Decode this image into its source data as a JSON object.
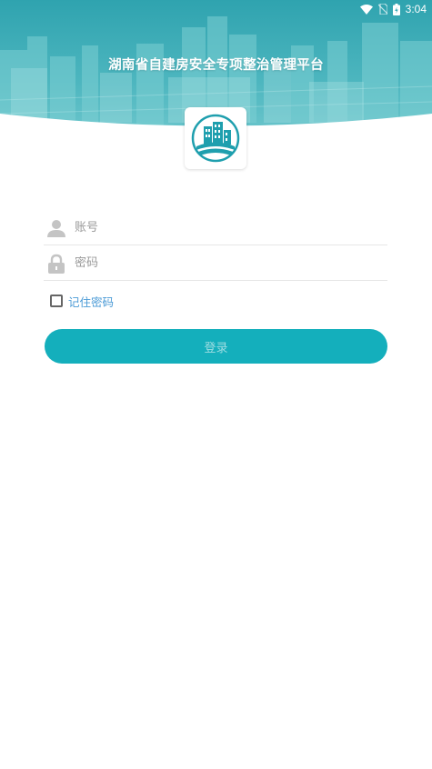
{
  "status_bar": {
    "time": "3:04",
    "icons": [
      "wifi-icon",
      "no-sim-icon",
      "battery-charging-icon"
    ]
  },
  "header": {
    "title": "湖南省自建房安全专项整治管理平台"
  },
  "login_form": {
    "account": {
      "placeholder": "账号",
      "value": "",
      "icon": "user-icon"
    },
    "password": {
      "placeholder": "密码",
      "value": "",
      "icon": "lock-icon"
    },
    "remember": {
      "label": "记住密码",
      "checked": false
    },
    "submit_label": "登录"
  },
  "colors": {
    "accent": "#14afbc",
    "link": "#4a9ad6",
    "banner": "#46b3bd"
  }
}
